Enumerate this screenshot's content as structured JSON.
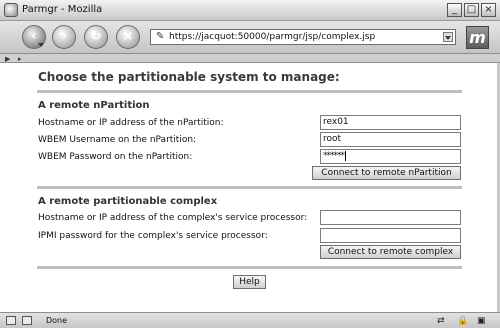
{
  "window": {
    "title": "Parmgr - Mozilla",
    "controls": {
      "minimize": "_",
      "maximize": "□",
      "close": "×"
    }
  },
  "toolbar": {
    "back_icon": "back-arrow-icon",
    "forward_icon": "forward-arrow-icon",
    "reload_icon": "reload-icon",
    "stop_icon": "stop-icon",
    "url": "https://jacquot:50000/parmgr/jsp/complex.jsp",
    "brand_logo": "m"
  },
  "tabstrip": {
    "left_arrow": "▶",
    "right_arrow": "▸"
  },
  "page": {
    "heading": "Choose the partitionable system to manage:",
    "npartition": {
      "section_title": "A remote nPartition",
      "hostname_label": "Hostname or IP address of the nPartition:",
      "hostname_value": "rex01",
      "username_label": "WBEM Username on the nPartition:",
      "username_value": "root",
      "password_label": "WBEM Password on the nPartition:",
      "password_value": "******",
      "connect_button": "Connect to remote nPartition"
    },
    "complex": {
      "section_title": "A remote partitionable complex",
      "hostname_label": "Hostname or IP address of the complex's service processor:",
      "hostname_value": "",
      "ipmi_label": "IPMI password for the complex's service processor:",
      "ipmi_value": "",
      "connect_button": "Connect to remote complex"
    },
    "help_button": "Help"
  },
  "statusbar": {
    "status": "Done"
  },
  "colors": {
    "window_chrome": "#d6d6d6",
    "rule": "#bdbdbd",
    "heading": "#3a3a3a"
  }
}
